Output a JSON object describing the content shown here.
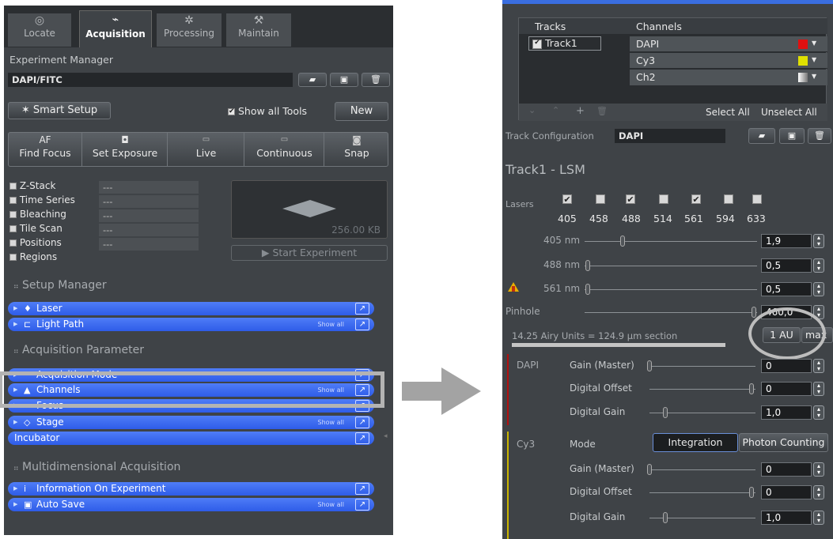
{
  "left_panel": {
    "tabs": [
      {
        "label": "Locate",
        "icon": "locate-icon"
      },
      {
        "label": "Acquisition",
        "icon": "acquisition-icon"
      },
      {
        "label": "Processing",
        "icon": "processing-icon"
      },
      {
        "label": "Maintain",
        "icon": "maintain-icon"
      }
    ],
    "experiment_manager": {
      "title": "Experiment Manager",
      "config_value": "DAPI/FITC"
    },
    "smart_setup_label": "Smart Setup",
    "show_all_tools_label": "Show all Tools",
    "new_label": "New",
    "toolbar": [
      {
        "line1": "AF",
        "line2": "Find Focus",
        "icon": "af-icon"
      },
      {
        "line1": "",
        "line2": "Set Exposure",
        "icon": "camera-icon"
      },
      {
        "line1": "",
        "line2": "Live",
        "icon": "live-icon"
      },
      {
        "line1": "",
        "line2": "Continuous",
        "icon": "continuous-icon"
      },
      {
        "line1": "",
        "line2": "Snap",
        "icon": "snap-icon"
      }
    ],
    "dimensions": [
      {
        "label": "Z-Stack",
        "value": "---"
      },
      {
        "label": "Time Series",
        "value": "---"
      },
      {
        "label": "Bleaching",
        "value": "---"
      },
      {
        "label": "Tile Scan",
        "value": "---"
      },
      {
        "label": "Positions",
        "value": "---"
      },
      {
        "label": "Regions",
        "value": ""
      }
    ],
    "size_label": "256.00 KB",
    "start_experiment_label": "Start Experiment",
    "sections": {
      "setup_manager": "Setup Manager",
      "acquisition_parameter": "Acquisition Parameter",
      "multidimensional": "Multidimensional Acquisition"
    },
    "setup_tools": [
      {
        "label": "Laser",
        "icon": "laser-icon",
        "show_all": ""
      },
      {
        "label": "Light Path",
        "icon": "light-path-icon",
        "show_all": "Show all"
      }
    ],
    "acq_tools": [
      {
        "label": "Acquisition Mode",
        "icon": "",
        "show_all": ""
      },
      {
        "label": "Channels",
        "icon": "channels-icon",
        "show_all": "Show all"
      },
      {
        "label": "Focus",
        "icon": "",
        "show_all": ""
      },
      {
        "label": "Stage",
        "icon": "stage-icon",
        "show_all": "Show all"
      },
      {
        "label": "Incubator",
        "icon": "",
        "show_all": ""
      }
    ],
    "multi_tools": [
      {
        "label": "Information On Experiment",
        "icon": "info-icon",
        "show_all": ""
      },
      {
        "label": "Auto Save",
        "icon": "save-icon",
        "show_all": "Show all"
      }
    ]
  },
  "right_panel": {
    "tracks_header": "Tracks",
    "channels_header": "Channels",
    "track_name": "Track1",
    "channels": [
      {
        "name": "DAPI",
        "color": "#e01010"
      },
      {
        "name": "Cy3",
        "color": "#e0e000"
      },
      {
        "name": "Ch2",
        "color": "#e8e8e8"
      }
    ],
    "select_all": "Select All",
    "unselect_all": "Unselect All",
    "track_config_label": "Track Configuration",
    "track_config_value": "DAPI",
    "track_title": "Track1 - LSM",
    "lasers_label": "Lasers",
    "lasers": [
      {
        "wl": "405",
        "checked": true
      },
      {
        "wl": "458",
        "checked": false
      },
      {
        "wl": "488",
        "checked": true
      },
      {
        "wl": "514",
        "checked": false
      },
      {
        "wl": "561",
        "checked": true
      },
      {
        "wl": "594",
        "checked": false
      },
      {
        "wl": "633",
        "checked": false
      }
    ],
    "power_rows": [
      {
        "label": "405 nm",
        "value": "1,9",
        "pos": 0.22
      },
      {
        "label": "488 nm",
        "value": "0,5",
        "pos": 0.02
      },
      {
        "label": "561 nm",
        "value": "0,5",
        "pos": 0.02
      }
    ],
    "pinhole_label": "Pinhole",
    "pinhole_value": "460,0",
    "pinhole_pos": 0.98,
    "airy_text": "14.25 Airy Units  =  124.9 µm section",
    "au_button": "1 AU",
    "max_button": "max",
    "dapi": {
      "name": "DAPI",
      "rows": [
        {
          "label": "Gain (Master)",
          "value": "0",
          "pos": 0.0
        },
        {
          "label": "Digital Offset",
          "value": "0",
          "pos": 0.96
        },
        {
          "label": "Digital Gain",
          "value": "1,0",
          "pos": 0.15
        }
      ]
    },
    "cy3": {
      "name": "Cy3",
      "mode_label": "Mode",
      "integration": "Integration",
      "photon_counting": "Photon Counting",
      "rows": [
        {
          "label": "Gain (Master)",
          "value": "0",
          "pos": 0.0
        },
        {
          "label": "Digital Offset",
          "value": "0",
          "pos": 0.96
        },
        {
          "label": "Digital Gain",
          "value": "1,0",
          "pos": 0.15
        }
      ]
    }
  }
}
